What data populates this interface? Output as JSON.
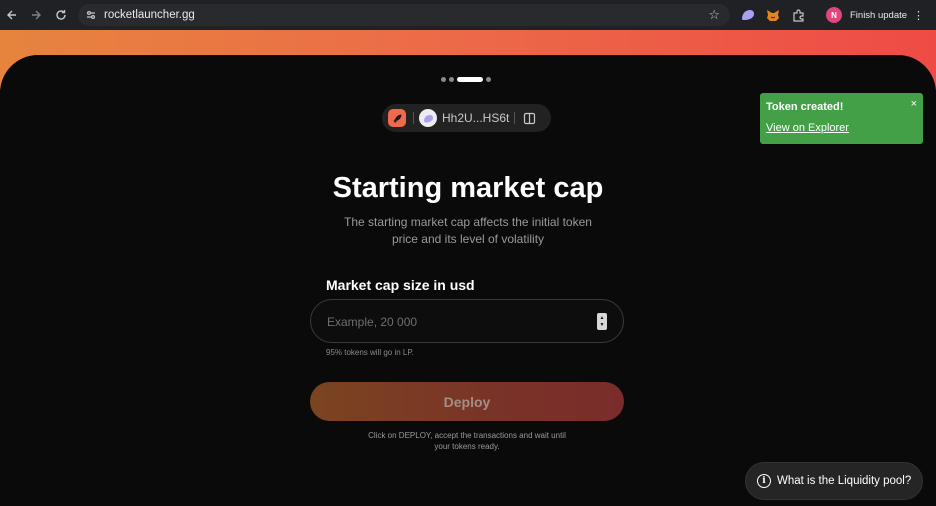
{
  "browser": {
    "url": "rocketlauncher.gg",
    "update_label": "Finish update",
    "profile_initial": "N"
  },
  "wallet": {
    "address": "Hh2U...HS6t"
  },
  "page": {
    "title": "Starting market cap",
    "subtitle": "The starting market cap affects the initial token price and its level of volatility"
  },
  "stepper": {
    "total_steps": 4,
    "active_step": 3
  },
  "form": {
    "label": "Market cap size in usd",
    "placeholder": "Example, 20 000",
    "value": "",
    "hint": "95% tokens will go in LP."
  },
  "deploy": {
    "label": "Deploy",
    "note": "Click on DEPLOY, accept the transactions and wait until your tokens ready."
  },
  "toast": {
    "title": "Token created!",
    "link": "View on Explorer",
    "close": "×"
  },
  "faq": {
    "label": "What is the Liquidity pool?"
  },
  "colors": {
    "accent_gradient_start": "#e6843e",
    "accent_gradient_end": "#ee4b45",
    "toast_bg": "#43a047",
    "background": "#0a0a0a"
  }
}
